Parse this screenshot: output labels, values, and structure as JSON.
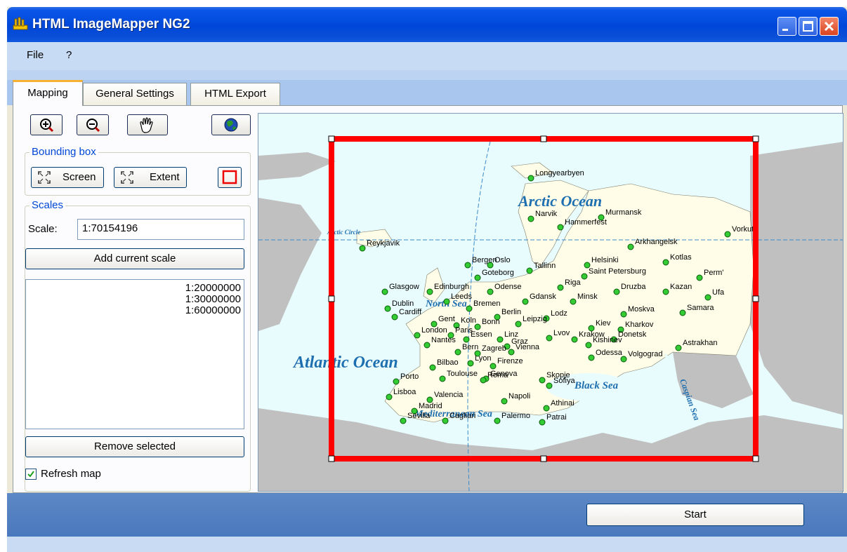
{
  "window": {
    "title": "HTML ImageMapper NG2",
    "colors": {
      "titlebar": "#0047d9",
      "menubar": "#c7dbf4",
      "statusbar": "#4a78bd",
      "selection": "#ff0000",
      "sea": "#e8fbfd",
      "land": "#fffde8"
    }
  },
  "menu": {
    "items": [
      "File",
      "?"
    ]
  },
  "tabs": [
    {
      "label": "Mapping",
      "active": true
    },
    {
      "label": "General Settings",
      "active": false
    },
    {
      "label": "HTML Export",
      "active": false
    }
  ],
  "toolbar": {
    "icons": [
      "zoom-in-icon",
      "zoom-out-icon",
      "pan-hand-icon",
      "globe-icon"
    ]
  },
  "bounding_box": {
    "label": "Bounding box",
    "screen_label": "Screen",
    "extent_label": "Extent"
  },
  "scales": {
    "label": "Scales",
    "scale_label": "Scale:",
    "scale_value": "1:70154196",
    "add_button": "Add current scale",
    "list": [
      "1:20000000",
      "1:30000000",
      "1:60000000"
    ],
    "remove_button": "Remove selected",
    "refresh_label": "Refresh map",
    "refresh_checked": true
  },
  "map": {
    "oceans": [
      "Arctic Ocean",
      "Atlantic Ocean",
      "North Sea",
      "Black Sea",
      "Mediterranean Sea",
      "Caspian Sea",
      "Arctic Circle"
    ],
    "cities": [
      "Longyearbyen",
      "Narvik",
      "Murmansk",
      "Hammerfest",
      "Vorkuta",
      "Reykjavik",
      "Arkhangelsk",
      "Kotlas",
      "Helsinki",
      "Bergen",
      "Oslo",
      "Tallinn",
      "Saint Petersburg",
      "Perm'",
      "Goteborg",
      "Glasgow",
      "Edinburgh",
      "Odense",
      "Riga",
      "Druzba",
      "Kazan",
      "Ufa",
      "Leeds",
      "Gdansk",
      "Minsk",
      "Dublin",
      "Bremen",
      "Moskva",
      "Samara",
      "Cardiff",
      "Berlin",
      "Lodz",
      "Gent",
      "Koln",
      "Bonn",
      "Leipzig",
      "Kiev",
      "Kharkov",
      "London",
      "Paris",
      "Essen",
      "Linz",
      "Lvov",
      "Krakow",
      "Donetsk",
      "Nantes",
      "Graz",
      "Kishinev",
      "Astrakhan",
      "Bern",
      "Zagreb",
      "Vienna",
      "Odessa",
      "Volgograd",
      "Bilbao",
      "Lyon",
      "Firenze",
      "Porto",
      "Toulouse",
      "Genova",
      "Roma",
      "Skopje",
      "Sofiya",
      "Lisboa",
      "Valencia",
      "Napoli",
      "Athinai",
      "Madrid",
      "Sevilla",
      "Cagliari",
      "Palermo",
      "Patrai"
    ]
  },
  "footer": {
    "start_button": "Start"
  }
}
